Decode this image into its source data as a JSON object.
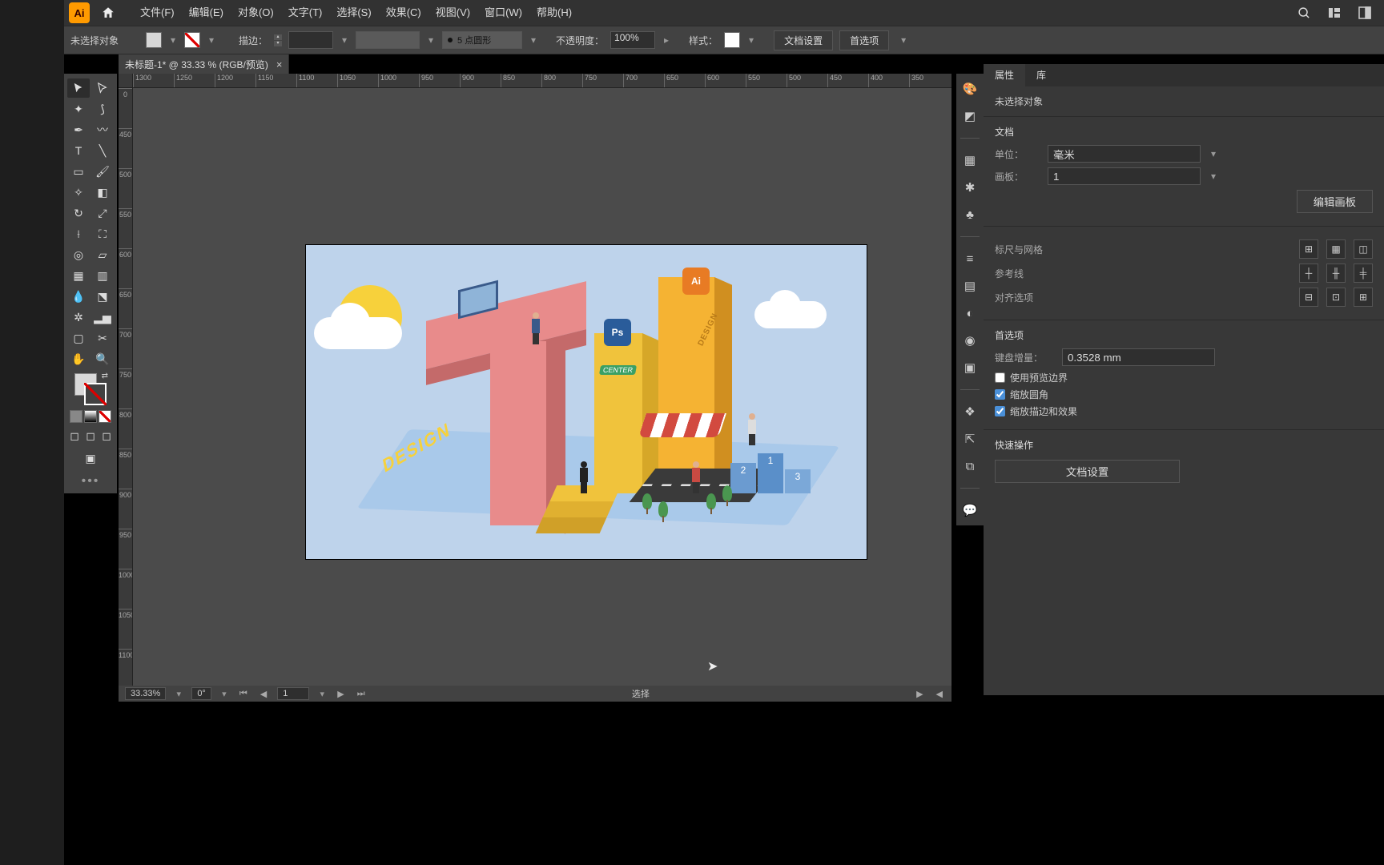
{
  "menubar": {
    "app_badge": "Ai",
    "items": [
      "文件(F)",
      "编辑(E)",
      "对象(O)",
      "文字(T)",
      "选择(S)",
      "效果(C)",
      "视图(V)",
      "窗口(W)",
      "帮助(H)"
    ]
  },
  "ctrl": {
    "no_sel": "未选择对象",
    "stroke_lbl": "描边：",
    "brush_val": "5 点圆形",
    "opacity_lbl": "不透明度：",
    "opacity_val": "100%",
    "style_lbl": "样式：",
    "doc_setup": "文档设置",
    "prefs": "首选项"
  },
  "tab": {
    "title": "未标题-1* @ 33.33 % (RGB/预览)"
  },
  "ruler_top": [
    "1300",
    "1250",
    "1200",
    "1150",
    "1100",
    "1050",
    "1000",
    "950",
    "900",
    "850",
    "800",
    "750",
    "700",
    "650",
    "600",
    "550",
    "500",
    "450",
    "400",
    "350"
  ],
  "ruler_left": [
    "0",
    "450",
    "500",
    "550",
    "600",
    "650",
    "700",
    "750",
    "800",
    "850",
    "900",
    "950",
    "1000",
    "1050",
    "1100"
  ],
  "art": {
    "design": "DESIGN",
    "center": "CENTER",
    "design2": "DESIGN",
    "ps": "Ps",
    "ai": "Ai",
    "pod": [
      "2",
      "1",
      "3"
    ]
  },
  "props": {
    "tabs": [
      "属性",
      "库"
    ],
    "no_sel": "未选择对象",
    "doc_section": "文档",
    "unit_lbl": "单位：",
    "unit_val": "毫米",
    "artboard_lbl": "画板：",
    "artboard_val": "1",
    "edit_artboards": "编辑画板",
    "ruler_grid": "标尺与网格",
    "guides": "参考线",
    "align_opts": "对齐选项",
    "prefs": "首选项",
    "key_inc_lbl": "键盘增量：",
    "key_inc_val": "0.3528 mm",
    "use_preview": "使用预览边界",
    "scale_corners": "缩放圆角",
    "scale_strokes": "缩放描边和效果",
    "quick": "快速操作",
    "doc_setup": "文档设置"
  },
  "status": {
    "zoom": "33.33%",
    "angle": "0°",
    "artboard": "1",
    "tool": "选择"
  }
}
